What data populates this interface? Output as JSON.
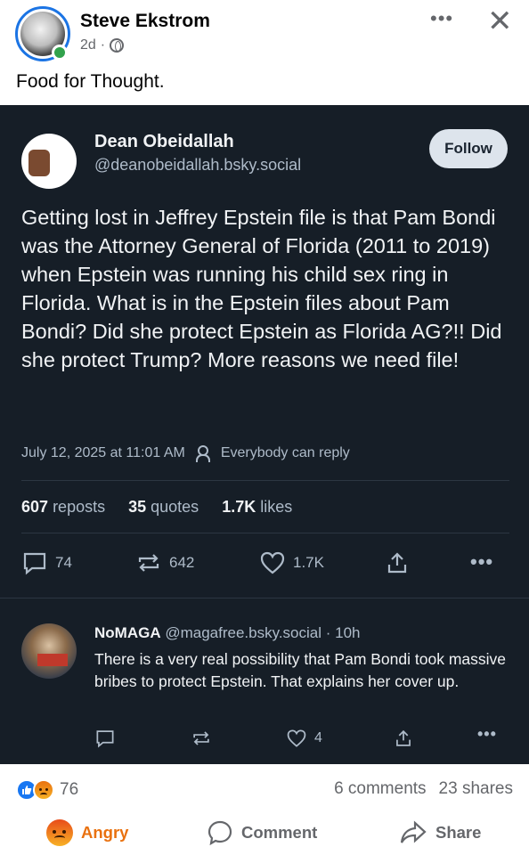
{
  "post": {
    "author": "Steve Ekstrom",
    "age": "2d",
    "privacy_separator": "·",
    "caption": "Food for Thought."
  },
  "embed": {
    "name": "Dean Obeidallah",
    "handle": "@deanobeidallah.bsky.social",
    "follow_label": "Follow",
    "text": "Getting lost in Jeffrey Epstein file is that Pam Bondi was the Attorney General of Florida (2011 to 2019) when Epstein was running his child sex ring in Florida. What is in the Epstein files about Pam Bondi? Did she protect Epstein as Florida AG?!! Did she protect Trump? More reasons we need file!",
    "date": "July 12, 2025 at 11:01 AM",
    "reply_setting": "Everybody can reply",
    "stats": {
      "reposts_count": "607",
      "reposts_label": "reposts",
      "quotes_count": "35",
      "quotes_label": "quotes",
      "likes_count": "1.7K",
      "likes_label": "likes"
    },
    "actions": {
      "replies": "74",
      "reposts": "642",
      "likes": "1.7K"
    },
    "reply": {
      "name": "NoMAGA",
      "handle": "@magafree.bsky.social",
      "age": "· 10h",
      "text": "There is a very real possibility that Pam Bondi took massive bribes to protect Epstein.  That explains her cover up.",
      "likes": "4"
    }
  },
  "footer": {
    "reaction_count": "76",
    "comments": "6 comments",
    "shares": "23 shares",
    "angry_label": "Angry",
    "comment_label": "Comment",
    "share_label": "Share"
  },
  "colors": {
    "card_bg": "#161e27",
    "fb_blue": "#1877f2",
    "angry_orange": "#e9710f",
    "online_green": "#31a24c"
  }
}
